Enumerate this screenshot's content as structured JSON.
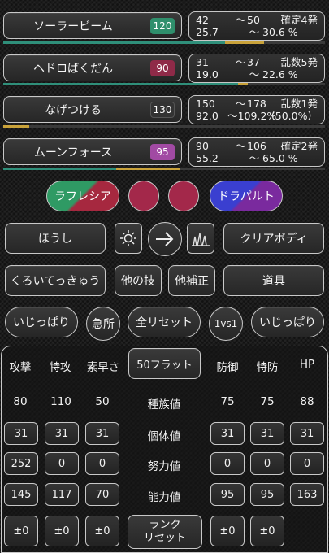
{
  "colors": {
    "teal": "#2f8f7a",
    "gold": "#c9a23a",
    "crimson": "#8f2a48",
    "grass": "#7cd6a0",
    "violet": "#a14aa3",
    "pokeball_red": "#a3284a",
    "ally_fill": "#3a9a6b",
    "foe_fill": "#3b3fc0"
  },
  "moves": [
    {
      "name": "ソーラービーム",
      "power": "120",
      "power_color": "#2f8f6c",
      "min_dmg": "42",
      "tilde": "〜",
      "max_dmg": "50",
      "min_pct": "25.7",
      "max_pct": "30.6 %",
      "ko": "確定4発",
      "ko2": "",
      "bar": [
        0.69,
        0.12
      ]
    },
    {
      "name": "ヘドロばくだん",
      "power": "90",
      "power_color": "#8f2a48",
      "min_dmg": "31",
      "tilde": "〜",
      "max_dmg": "37",
      "min_pct": "19.0",
      "max_pct": "22.6 %",
      "ko": "乱数5発",
      "ko2": "",
      "bar": [
        0.73,
        0.0
      ]
    },
    {
      "name": "なげつける",
      "power": "130",
      "power_color": "#3a3a3a",
      "min_dmg": "150",
      "tilde": "〜",
      "max_dmg": "178",
      "min_pct": "92.0",
      "max_pct": "〜109.2%",
      "ko": "乱数1発",
      "ko2": "（50.0%）",
      "bar": [
        0.0,
        0.08
      ]
    },
    {
      "name": "ムーンフォース",
      "power": "95",
      "power_color": "#a14aa3",
      "min_dmg": "90",
      "tilde": "〜",
      "max_dmg": "106",
      "min_pct": "55.2",
      "max_pct": "65.0 %",
      "ko": "確定2発",
      "ko2": "",
      "bar": [
        0.35,
        0.2
      ]
    }
  ],
  "ally": "ラフレシア",
  "foe": "ドラパルト",
  "row1": {
    "ability_left": "ほうし",
    "weather_icon": "sun-icon",
    "arrow_icon": "arrow-right-icon",
    "terrain_icon": "grass-terrain-icon",
    "ability_right": "クリアボディ"
  },
  "row2": {
    "item_left": "くろいてっきゅう",
    "other_move": "他の技",
    "other_mod": "他補正",
    "item_right": "道具"
  },
  "row3": {
    "nature_left": "いじっぱり",
    "crit": "急所",
    "reset_all": "全リセット",
    "mode": "1vs1",
    "nature_right": "いじっぱり"
  },
  "stats": {
    "headers_left": [
      "攻撃",
      "特攻",
      "素早さ"
    ],
    "flat_button": "50フラット",
    "headers_right": [
      "防御",
      "特防",
      "HP"
    ],
    "base_label": "種族値",
    "iv_label": "個体値",
    "ev_label": "努力値",
    "stat_label": "能力値",
    "base_left": [
      "80",
      "110",
      "50"
    ],
    "base_right": [
      "75",
      "75",
      "88"
    ],
    "iv_left": [
      "31",
      "31",
      "31"
    ],
    "iv_right": [
      "31",
      "31",
      "31"
    ],
    "ev_left": [
      "252",
      "0",
      "0"
    ],
    "ev_right": [
      "0",
      "0",
      "0"
    ],
    "stat_left": [
      "145",
      "117",
      "70"
    ],
    "stat_right": [
      "95",
      "95",
      "163"
    ],
    "rank_left": [
      "±0",
      "±0",
      "±0"
    ],
    "rank_right": [
      "±0",
      "±0"
    ],
    "rank_reset": "ランク\nリセット"
  }
}
